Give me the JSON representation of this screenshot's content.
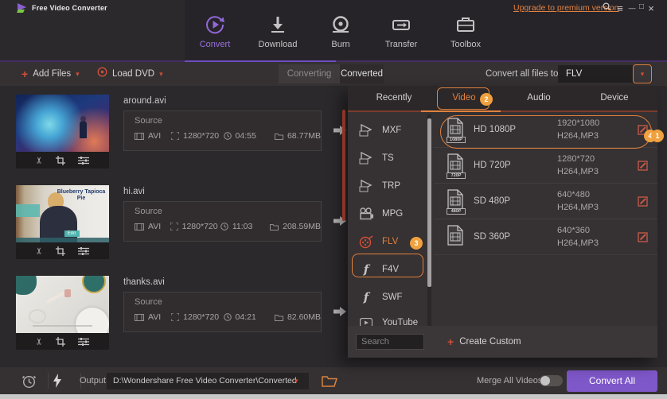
{
  "titlebar": {
    "app_title": "Free Video Converter",
    "upgrade_link": "Upgrade to premium version"
  },
  "nav": {
    "items": [
      {
        "label": "Convert",
        "active": true
      },
      {
        "label": "Download",
        "active": false
      },
      {
        "label": "Burn",
        "active": false
      },
      {
        "label": "Transfer",
        "active": false
      },
      {
        "label": "Toolbox",
        "active": false
      }
    ]
  },
  "toolbar": {
    "add_files_label": "Add Files",
    "load_dvd_label": "Load DVD",
    "converting_tab": "Converting",
    "converted_tab": "Converted",
    "convert_all_label": "Convert all files to:",
    "format_value": "FLV",
    "step_badge": "1"
  },
  "list": {
    "source_label": "Source"
  },
  "files": [
    {
      "name": "around.avi",
      "format": "AVI",
      "resolution": "1280*720",
      "duration": "04:55",
      "size": "68.77MB"
    },
    {
      "name": "hi.avi",
      "format": "AVI",
      "resolution": "1280*720",
      "duration": "11:03",
      "size": "208.59MB",
      "thumb_title": "Blueberry Tapioca Pie",
      "thumb_tag": "Erin"
    },
    {
      "name": "thanks.avi",
      "format": "AVI",
      "resolution": "1280*720",
      "duration": "04:21",
      "size": "82.60MB"
    }
  ],
  "format_panel": {
    "tabs": [
      {
        "label": "Recently",
        "active": false
      },
      {
        "label": "Video",
        "active": true,
        "badge": "2"
      },
      {
        "label": "Audio",
        "active": false
      },
      {
        "label": "Device",
        "active": false
      }
    ],
    "formats": [
      {
        "label": "MXF"
      },
      {
        "label": "TS"
      },
      {
        "label": "TRP"
      },
      {
        "label": "MPG"
      },
      {
        "label": "FLV",
        "selected": true,
        "badge": "3"
      },
      {
        "label": "F4V"
      },
      {
        "label": "SWF"
      },
      {
        "label": "YouTube"
      }
    ],
    "presets": [
      {
        "name": "HD 1080P",
        "icon_label": "1080P",
        "resolution": "1920*1080",
        "codec": "H264,MP3",
        "highlighted": true,
        "badge": "4"
      },
      {
        "name": "HD 720P",
        "icon_label": "720P",
        "resolution": "1280*720",
        "codec": "H264,MP3"
      },
      {
        "name": "SD 480P",
        "icon_label": "480P",
        "resolution": "640*480",
        "codec": "H264,MP3"
      },
      {
        "name": "SD 360P",
        "icon_label": "",
        "resolution": "640*360",
        "codec": "H264,MP3"
      }
    ],
    "search_placeholder": "Search",
    "create_custom_label": "Create Custom"
  },
  "bottombar": {
    "output_label": "Output",
    "output_path": "D:\\Wondershare Free Video Converter\\Converted",
    "merge_label": "Merge All Videos",
    "merge_enabled": false,
    "convert_all_button": "Convert All"
  },
  "icons": {
    "caret_down": "▾",
    "plus": "+",
    "menu": "≡",
    "minimize": "—",
    "maximize": "□",
    "close": "×",
    "scissors": "✂"
  },
  "colors": {
    "accent_purple": "#7e57c9",
    "accent_orange": "#e0813f",
    "accent_red": "#cf4f38",
    "badge_orange": "#f0a13f"
  }
}
